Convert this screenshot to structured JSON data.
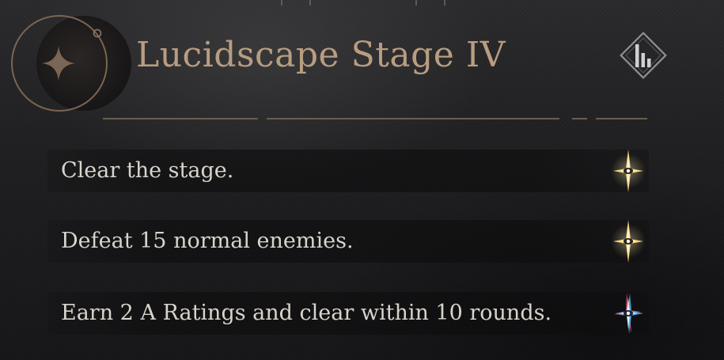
{
  "stage": {
    "title": "Lucidscape Stage IV"
  },
  "missions": [
    {
      "text": "Clear the stage.",
      "status_icon": "gold-star-icon",
      "completed": true
    },
    {
      "text": "Defeat 15 normal enemies.",
      "status_icon": "gold-star-icon",
      "completed": true
    },
    {
      "text": "Earn 2 A Ratings and clear within 10 rounds.",
      "status_icon": "prismatic-star-icon",
      "completed": true
    }
  ],
  "icons": {
    "emblem": "four-point-star-orbit-emblem",
    "rank": "bar-rank-diamond-icon"
  },
  "colors": {
    "title": "#b89d80",
    "mission_text": "#d8d4cc",
    "divider": "#6b5d4e",
    "gold_star": "#f3d27a"
  }
}
